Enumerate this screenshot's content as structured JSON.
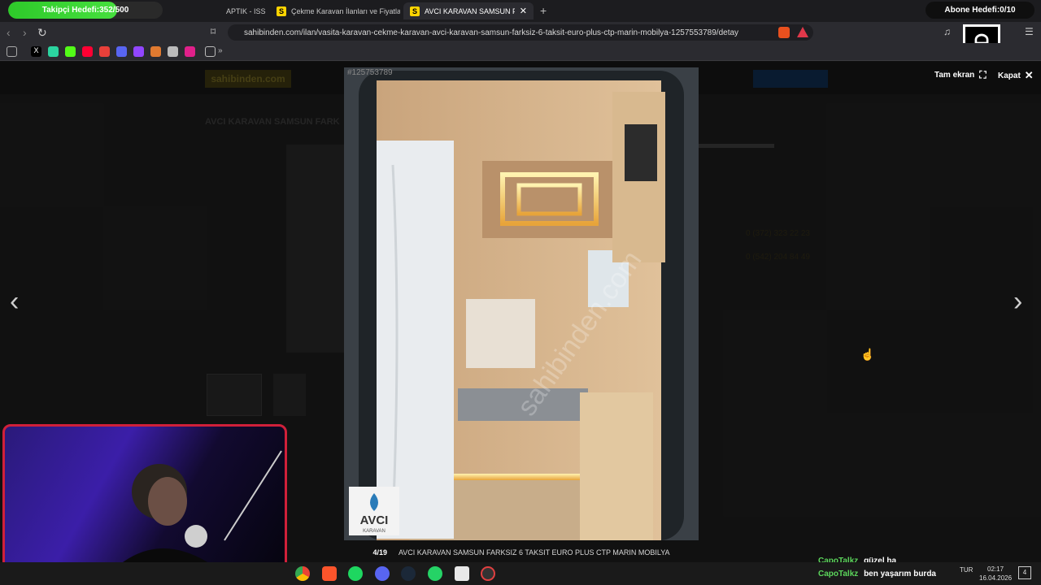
{
  "overlay": {
    "follower_goal_text": "Takipçi Hedefi:352/500",
    "follower_progress": 0.704,
    "sub_goal_text": "Abone Hedefi:0/10"
  },
  "browser": {
    "tabs": [
      {
        "label": "APTIK - ISS",
        "icon": "shield-icon"
      },
      {
        "label": "Çekme Karavan İlanları ve Fiyatları sa",
        "icon": "sahibinden-icon"
      },
      {
        "label": "AVCI KARAVAN SAMSUN FARKS",
        "icon": "sahibinden-icon",
        "active": true
      }
    ],
    "url": "sahibinden.com/ilan/vasita-karavan-cekme-karavan-avci-karavan-samsun-farksiz-6-taksit-euro-plus-ctp-marin-mobilya-1257553789/detay",
    "bookmark_more": "»"
  },
  "site": {
    "logo": "sahibinden.com",
    "listing_title": "AVCI KARAVAN SAMSUN FARK",
    "phone1": "0 (372) 323 22 23",
    "phone2": "0 (542) 204 84 49"
  },
  "lightbox": {
    "image_id": "#125753789",
    "counter": "4/19",
    "caption": "AVCI KARAVAN SAMSUN FARKSIZ 6 TAKSIT EURO PLUS CTP MARIN MOBILYA",
    "fullscreen_label": "Tam ekran",
    "close_label": "Kapat",
    "watermark": "sahibinden.com",
    "photo_logo_brand": "AVCI",
    "photo_logo_sub": "KARAVAN"
  },
  "chat": [
    {
      "user": "CapoTalkz",
      "message": "güzel ha"
    },
    {
      "user": "CapoTalkz",
      "message": "ben yaşarım burda"
    }
  ],
  "taskbar": {
    "lang": "TUR",
    "time": "02:17",
    "date": "16.04.2026",
    "notifications": "4"
  },
  "colors": {
    "follower_bar": "#46e03e",
    "webcam_border": "#d0203a",
    "chat_user": "#5cd65c"
  }
}
